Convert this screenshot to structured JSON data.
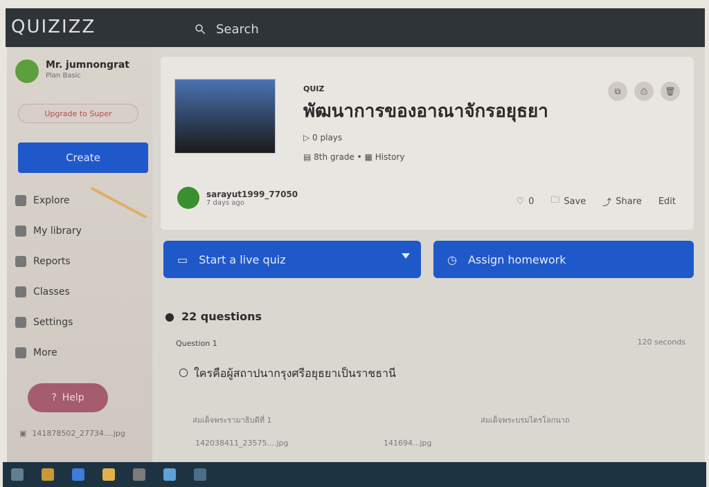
{
  "app": {
    "logo": "QUIZIZZ",
    "search_placeholder": "Search"
  },
  "sidebar": {
    "profile": {
      "name": "Mr. jumnongrat",
      "plan": "Plan Basic"
    },
    "upgrade_label": "Upgrade to Super",
    "create_label": "Create",
    "nav": [
      {
        "label": "Explore"
      },
      {
        "label": "My library"
      },
      {
        "label": "Reports"
      },
      {
        "label": "Classes"
      },
      {
        "label": "Settings"
      },
      {
        "label": "More"
      }
    ],
    "help_label": "Help",
    "recent_file": "141878502_27734....jpg"
  },
  "quiz": {
    "label": "QUIZ",
    "title": "พัฒนาการของอาณาจักรอยุธยา",
    "plays": "0 plays",
    "grade": "8th grade",
    "subject": "History",
    "author": "sarayut1999_77050",
    "when": "7 days ago",
    "likes": "0",
    "save_label": "Save",
    "share_label": "Share",
    "edit_label": "Edit",
    "start_label": "Start a live quiz",
    "assign_label": "Assign homework",
    "questions_count": "22 questions",
    "question_label": "Question 1",
    "question_text": "ใครคือผู้สถาปนากรุงศรีอยุธยาเป็นราชธานี",
    "timer": "120 seconds",
    "answer_1": "สมเด็จพระรามาธิบดีที่ 1",
    "answer_2": "สมเด็จพระบรมไตรโลกนาถ",
    "file_1": "142038411_23575....jpg",
    "file_2": "141694...jpg"
  }
}
